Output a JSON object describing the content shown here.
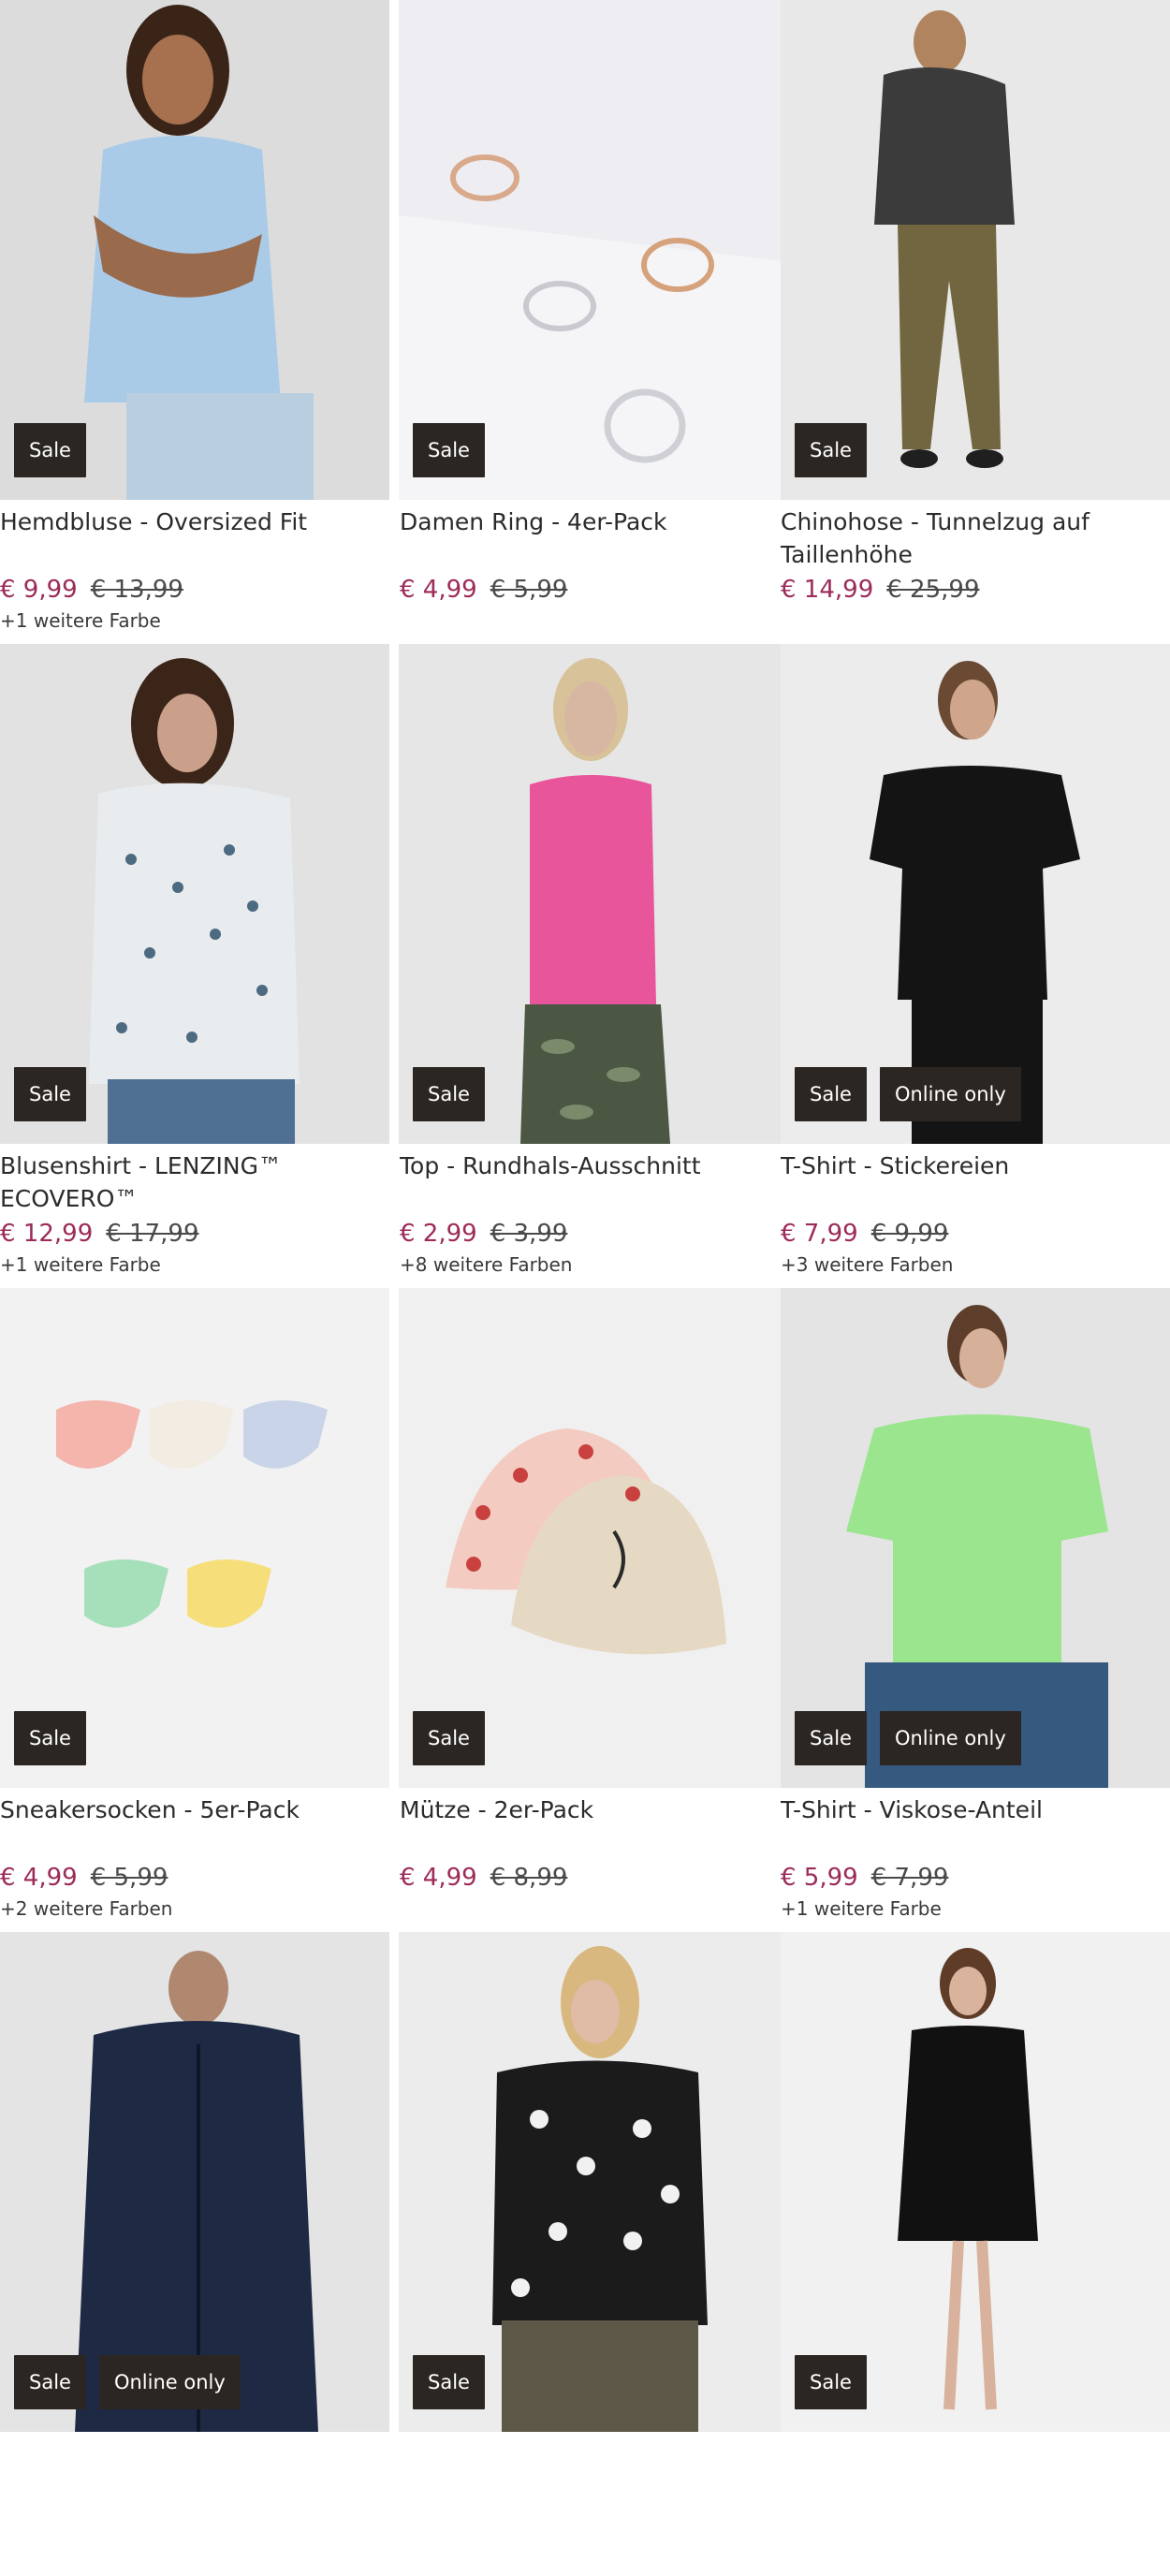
{
  "products": [
    {
      "title": "Hemdbluse - Oversized Fit",
      "price": "€ 9,99",
      "old_price": "€ 13,99",
      "more": "+1 weitere Farbe",
      "badges": [
        "Sale"
      ]
    },
    {
      "title": "Damen Ring - 4er-Pack",
      "price": "€ 4,99",
      "old_price": "€ 5,99",
      "more": "",
      "badges": [
        "Sale"
      ]
    },
    {
      "title": "Chinohose - Tunnelzug auf Taillenhöhe",
      "price": "€ 14,99",
      "old_price": "€ 25,99",
      "more": "",
      "badges": [
        "Sale"
      ]
    },
    {
      "title": "Blusenshirt - LENZING™ ECOVERO™",
      "price": "€ 12,99",
      "old_price": "€ 17,99",
      "more": "+1 weitere Farbe",
      "badges": [
        "Sale"
      ]
    },
    {
      "title": "Top - Rundhals-Ausschnitt",
      "price": "€ 2,99",
      "old_price": "€ 3,99",
      "more": "+8 weitere Farben",
      "badges": [
        "Sale"
      ]
    },
    {
      "title": "T-Shirt - Stickereien",
      "price": "€ 7,99",
      "old_price": "€ 9,99",
      "more": "+3 weitere Farben",
      "badges": [
        "Sale",
        "Online only"
      ]
    },
    {
      "title": "Sneakersocken - 5er-Pack",
      "price": "€ 4,99",
      "old_price": "€ 5,99",
      "more": "+2 weitere Farben",
      "badges": [
        "Sale"
      ]
    },
    {
      "title": "Mütze - 2er-Pack",
      "price": "€ 4,99",
      "old_price": "€ 8,99",
      "more": "",
      "badges": [
        "Sale"
      ]
    },
    {
      "title": "T-Shirt - Viskose-Anteil",
      "price": "€ 5,99",
      "old_price": "€ 7,99",
      "more": "+1 weitere Farbe",
      "badges": [
        "Sale",
        "Online only"
      ]
    },
    {
      "title": "",
      "price": "",
      "old_price": "",
      "more": "",
      "badges": [
        "Sale",
        "Online only"
      ]
    },
    {
      "title": "",
      "price": "",
      "old_price": "",
      "more": "",
      "badges": [
        "Sale"
      ]
    },
    {
      "title": "",
      "price": "",
      "old_price": "",
      "more": "",
      "badges": [
        "Sale"
      ]
    }
  ],
  "colors": {
    "price_sale": "#9c2a5a",
    "badge_bg": "#2b2622",
    "badge_text": "#ffffff"
  }
}
